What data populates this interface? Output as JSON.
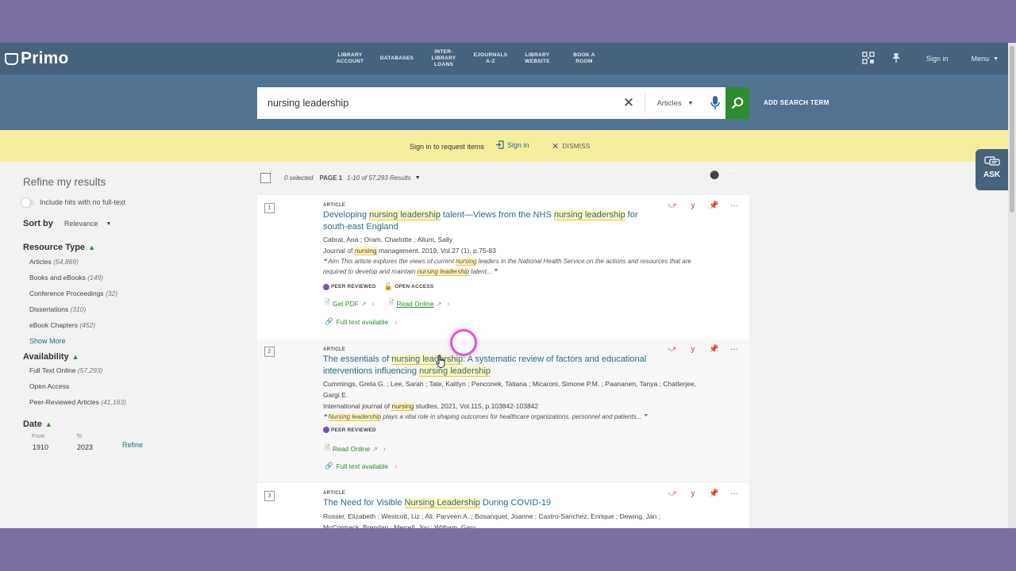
{
  "header": {
    "logo": "Primo",
    "nav": [
      {
        "label": "LIBRARY\nACCOUNT"
      },
      {
        "label": "DATABASES"
      },
      {
        "label": "INTER-\nLIBRARY\nLOANS"
      },
      {
        "label": "EJOURNALS\nA-Z"
      },
      {
        "label": "LIBRARY\nWEBSITE"
      },
      {
        "label": "BOOK A\nROOM"
      }
    ],
    "sign_in": "Sign in",
    "menu": "Menu"
  },
  "search": {
    "query": "nursing leadership",
    "scope": "Articles",
    "add_term": "ADD SEARCH TERM"
  },
  "banner": {
    "text": "Sign in to request items",
    "sign_in": "Sign in",
    "dismiss": "DISMISS"
  },
  "ask": "ASK",
  "sidebar": {
    "title": "Refine my results",
    "toggle_label": "Include hits with no full-text",
    "sort_label": "Sort by",
    "sort_value": "Relevance",
    "resource_type": {
      "heading": "Resource Type",
      "items": [
        {
          "name": "Articles",
          "count": "(54,869)"
        },
        {
          "name": "Books and eBooks",
          "count": "(149)"
        },
        {
          "name": "Conference Proceedings",
          "count": "(32)"
        },
        {
          "name": "Dissertations",
          "count": "(310)"
        },
        {
          "name": "eBook Chapters",
          "count": "(452)"
        }
      ],
      "show_more": "Show More"
    },
    "availability": {
      "heading": "Availability",
      "items": [
        {
          "name": "Full Text Online",
          "count": "(57,293)"
        },
        {
          "name": "Open Access",
          "count": ""
        },
        {
          "name": "Peer-Reviewed Articles",
          "count": "(41,163)"
        }
      ]
    },
    "date": {
      "heading": "Date",
      "from_label": "From",
      "to_label": "To",
      "from": "1910",
      "to": "2023",
      "refine": "Refine"
    }
  },
  "results_header": {
    "selected": "0 selected",
    "page": "PAGE 1",
    "range": "1-10 of 57,293 Results"
  },
  "results": [
    {
      "num": "1",
      "type": "ARTICLE",
      "title_parts": [
        "Developing ",
        "nursing leadership",
        " talent—Views from the NHS ",
        "nursing leadership",
        " for south-east England"
      ],
      "authors": "Cabral, Ana ; Oram, Charlotte ; Allum, Sally",
      "source_parts": [
        "Journal of ",
        "nursing",
        " management, 2019, Vol.27 (1), p.75-83"
      ],
      "snippet_parts": [
        "❝  Aim This article explores the views of current ",
        "nursing",
        " leaders in the National Health Service on the actions and resources that are required to develop and maintain ",
        "nursing leadership",
        " talent... ❞"
      ],
      "badges": [
        "PEER REVIEWED",
        "OPEN ACCESS"
      ],
      "links": [
        "Get PDF",
        "Read Online"
      ],
      "fulltext": "Full text available"
    },
    {
      "num": "2",
      "type": "ARTICLE",
      "title_parts": [
        "The essentials of ",
        "nursing leadership",
        ": A systematic review of factors and educational interventions influencing ",
        "nursing leadership",
        ""
      ],
      "authors": "Cummings, Greta G. ; Lee, Sarah ; Tate, Kaitlyn ; Penconek, Tatiana ; Micaroni, Simone P.M. ; Paananen, Tanya ; Chatterjee, Gargi E.",
      "source_parts": [
        "International journal of ",
        "nursing",
        " studies, 2021, Vol.115, p.103842-103842"
      ],
      "snippet_parts": [
        "❝  ",
        "Nursing leadership",
        " plays a vital role in shaping outcomes for healthcare organizations, personnel and patients... ❞",
        "",
        ""
      ],
      "badges": [
        "PEER REVIEWED"
      ],
      "links": [
        "Read Online"
      ],
      "fulltext": "Full text available"
    },
    {
      "num": "3",
      "type": "ARTICLE",
      "title_parts": [
        "The Need for Visible ",
        "Nursing Leadership",
        " During COVID-19",
        "",
        ""
      ],
      "authors": "Rosser, Elizabeth ; Westcott, Liz ; Ali, Parveen A. ; Bosanquet, Joanne ; Castro-Sanchez, Enrique ; Dewing, Jan ; McCormack, Brendan ; Merrell, Joy ; Witham, Gary"
    }
  ],
  "colors": {
    "header": "#46627c",
    "search_band": "#4f7391",
    "banner": "#f6ee9f",
    "accent_green": "#2e8b2e",
    "link_blue": "#2b6a87",
    "frame": "#7b6fa3"
  }
}
